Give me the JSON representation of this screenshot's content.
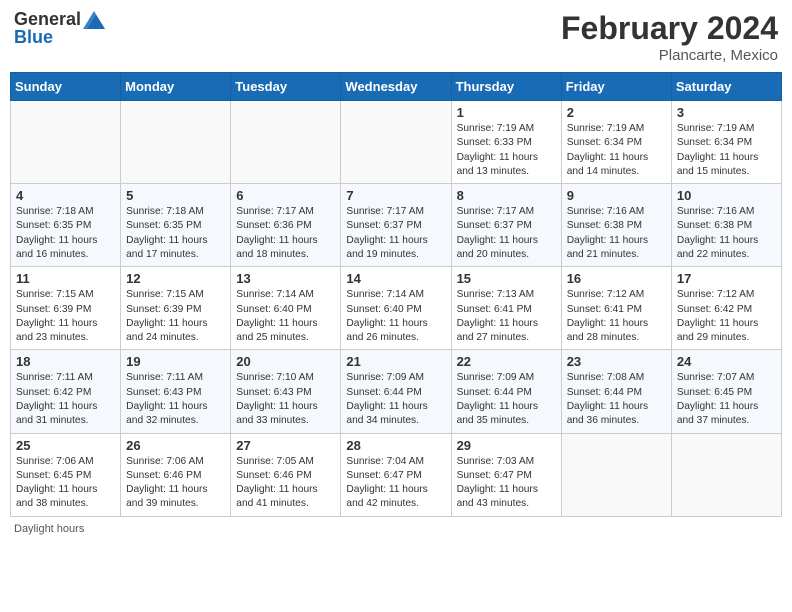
{
  "header": {
    "logo_general": "General",
    "logo_blue": "Blue",
    "month_year": "February 2024",
    "location": "Plancarte, Mexico"
  },
  "days_of_week": [
    "Sunday",
    "Monday",
    "Tuesday",
    "Wednesday",
    "Thursday",
    "Friday",
    "Saturday"
  ],
  "footer": {
    "note": "Daylight hours"
  },
  "weeks": [
    [
      {
        "day": "",
        "info": ""
      },
      {
        "day": "",
        "info": ""
      },
      {
        "day": "",
        "info": ""
      },
      {
        "day": "",
        "info": ""
      },
      {
        "day": "1",
        "info": "Sunrise: 7:19 AM\nSunset: 6:33 PM\nDaylight: 11 hours\nand 13 minutes."
      },
      {
        "day": "2",
        "info": "Sunrise: 7:19 AM\nSunset: 6:34 PM\nDaylight: 11 hours\nand 14 minutes."
      },
      {
        "day": "3",
        "info": "Sunrise: 7:19 AM\nSunset: 6:34 PM\nDaylight: 11 hours\nand 15 minutes."
      }
    ],
    [
      {
        "day": "4",
        "info": "Sunrise: 7:18 AM\nSunset: 6:35 PM\nDaylight: 11 hours\nand 16 minutes."
      },
      {
        "day": "5",
        "info": "Sunrise: 7:18 AM\nSunset: 6:35 PM\nDaylight: 11 hours\nand 17 minutes."
      },
      {
        "day": "6",
        "info": "Sunrise: 7:17 AM\nSunset: 6:36 PM\nDaylight: 11 hours\nand 18 minutes."
      },
      {
        "day": "7",
        "info": "Sunrise: 7:17 AM\nSunset: 6:37 PM\nDaylight: 11 hours\nand 19 minutes."
      },
      {
        "day": "8",
        "info": "Sunrise: 7:17 AM\nSunset: 6:37 PM\nDaylight: 11 hours\nand 20 minutes."
      },
      {
        "day": "9",
        "info": "Sunrise: 7:16 AM\nSunset: 6:38 PM\nDaylight: 11 hours\nand 21 minutes."
      },
      {
        "day": "10",
        "info": "Sunrise: 7:16 AM\nSunset: 6:38 PM\nDaylight: 11 hours\nand 22 minutes."
      }
    ],
    [
      {
        "day": "11",
        "info": "Sunrise: 7:15 AM\nSunset: 6:39 PM\nDaylight: 11 hours\nand 23 minutes."
      },
      {
        "day": "12",
        "info": "Sunrise: 7:15 AM\nSunset: 6:39 PM\nDaylight: 11 hours\nand 24 minutes."
      },
      {
        "day": "13",
        "info": "Sunrise: 7:14 AM\nSunset: 6:40 PM\nDaylight: 11 hours\nand 25 minutes."
      },
      {
        "day": "14",
        "info": "Sunrise: 7:14 AM\nSunset: 6:40 PM\nDaylight: 11 hours\nand 26 minutes."
      },
      {
        "day": "15",
        "info": "Sunrise: 7:13 AM\nSunset: 6:41 PM\nDaylight: 11 hours\nand 27 minutes."
      },
      {
        "day": "16",
        "info": "Sunrise: 7:12 AM\nSunset: 6:41 PM\nDaylight: 11 hours\nand 28 minutes."
      },
      {
        "day": "17",
        "info": "Sunrise: 7:12 AM\nSunset: 6:42 PM\nDaylight: 11 hours\nand 29 minutes."
      }
    ],
    [
      {
        "day": "18",
        "info": "Sunrise: 7:11 AM\nSunset: 6:42 PM\nDaylight: 11 hours\nand 31 minutes."
      },
      {
        "day": "19",
        "info": "Sunrise: 7:11 AM\nSunset: 6:43 PM\nDaylight: 11 hours\nand 32 minutes."
      },
      {
        "day": "20",
        "info": "Sunrise: 7:10 AM\nSunset: 6:43 PM\nDaylight: 11 hours\nand 33 minutes."
      },
      {
        "day": "21",
        "info": "Sunrise: 7:09 AM\nSunset: 6:44 PM\nDaylight: 11 hours\nand 34 minutes."
      },
      {
        "day": "22",
        "info": "Sunrise: 7:09 AM\nSunset: 6:44 PM\nDaylight: 11 hours\nand 35 minutes."
      },
      {
        "day": "23",
        "info": "Sunrise: 7:08 AM\nSunset: 6:44 PM\nDaylight: 11 hours\nand 36 minutes."
      },
      {
        "day": "24",
        "info": "Sunrise: 7:07 AM\nSunset: 6:45 PM\nDaylight: 11 hours\nand 37 minutes."
      }
    ],
    [
      {
        "day": "25",
        "info": "Sunrise: 7:06 AM\nSunset: 6:45 PM\nDaylight: 11 hours\nand 38 minutes."
      },
      {
        "day": "26",
        "info": "Sunrise: 7:06 AM\nSunset: 6:46 PM\nDaylight: 11 hours\nand 39 minutes."
      },
      {
        "day": "27",
        "info": "Sunrise: 7:05 AM\nSunset: 6:46 PM\nDaylight: 11 hours\nand 41 minutes."
      },
      {
        "day": "28",
        "info": "Sunrise: 7:04 AM\nSunset: 6:47 PM\nDaylight: 11 hours\nand 42 minutes."
      },
      {
        "day": "29",
        "info": "Sunrise: 7:03 AM\nSunset: 6:47 PM\nDaylight: 11 hours\nand 43 minutes."
      },
      {
        "day": "",
        "info": ""
      },
      {
        "day": "",
        "info": ""
      }
    ]
  ]
}
